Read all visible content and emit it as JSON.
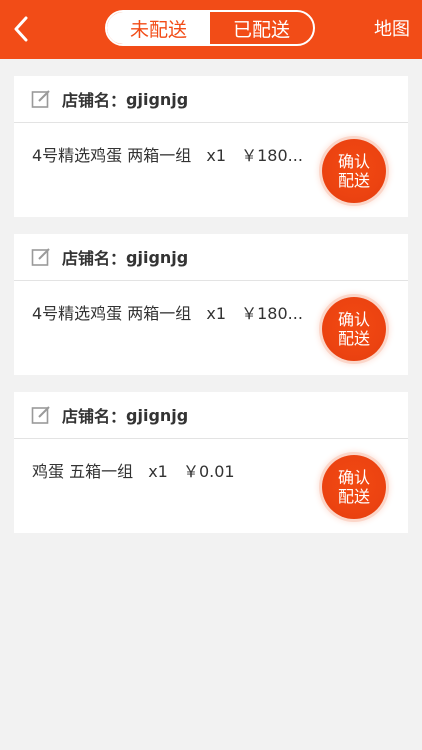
{
  "header": {
    "tabs": [
      {
        "label": "未配送",
        "active": true
      },
      {
        "label": "已配送",
        "active": false
      }
    ],
    "map_label": "地图"
  },
  "colors": {
    "brand": "#f24c17",
    "background": "#f2f2f2",
    "card": "#ffffff"
  },
  "orders": [
    {
      "shop_label": "店铺名：",
      "shop_name": "gjignjg",
      "item": "4号精选鸡蛋 两箱一组",
      "qty": "x1",
      "price": "￥180...",
      "confirm_line1": "确认",
      "confirm_line2": "配送"
    },
    {
      "shop_label": "店铺名：",
      "shop_name": "gjignjg",
      "item": "4号精选鸡蛋 两箱一组",
      "qty": "x1",
      "price": "￥180...",
      "confirm_line1": "确认",
      "confirm_line2": "配送"
    },
    {
      "shop_label": "店铺名：",
      "shop_name": "gjignjg",
      "item": "鸡蛋 五箱一组",
      "qty": "x1",
      "price": "￥0.01",
      "confirm_line1": "确认",
      "confirm_line2": "配送"
    }
  ],
  "icons": {
    "back": "back-arrow-icon",
    "edit": "edit-icon"
  }
}
